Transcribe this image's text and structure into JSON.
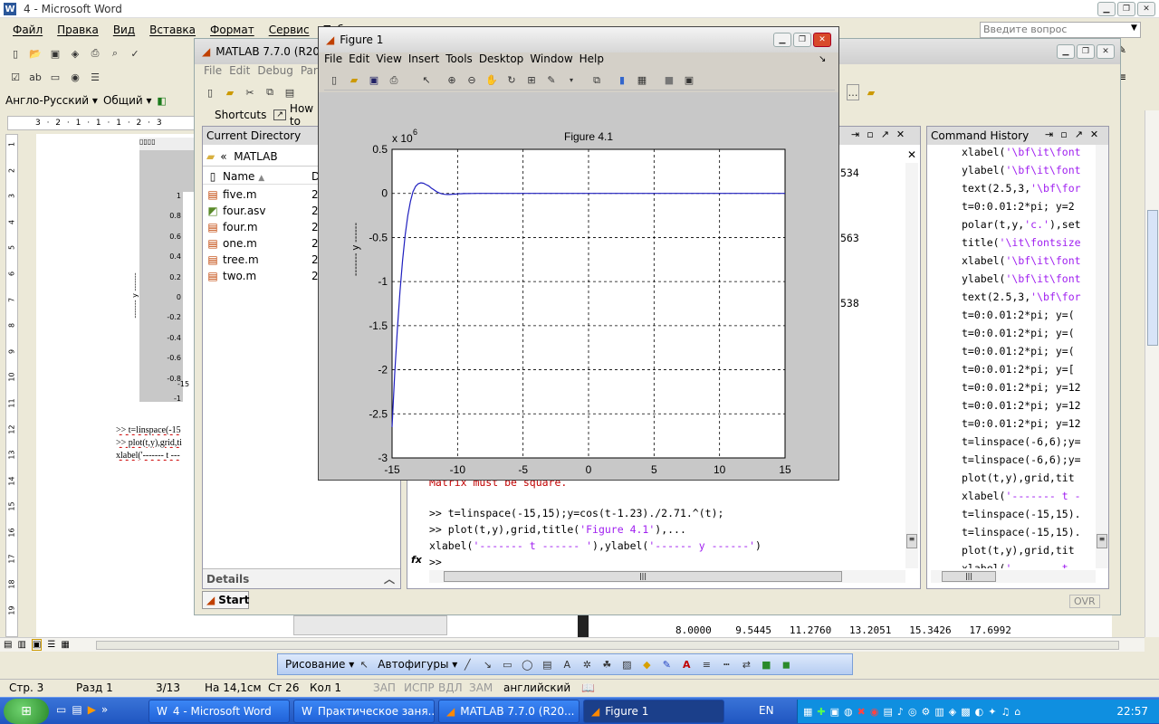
{
  "word": {
    "title": "4 - Microsoft Word",
    "menu": [
      "Файл",
      "Правка",
      "Вид",
      "Вставка",
      "Формат",
      "Сервис",
      "Табл"
    ],
    "ask_placeholder": "Введите вопрос",
    "style_box": "Англо-Русский",
    "font_box": "Общий",
    "left_ruler": [
      "1",
      "2",
      "3",
      "4",
      "5",
      "6",
      "7",
      "8",
      "9",
      "10",
      "11",
      "12",
      "13",
      "14",
      "15",
      "16",
      "17",
      "18",
      "19"
    ],
    "doc_lines": [
      ">> t=linspace(-15",
      ">> plot(t,y),grid,ti",
      "xlabel('------- t ---"
    ],
    "thumb_ticks": [
      "1",
      "0.8",
      "0.6",
      "0.4",
      "0.2",
      "0",
      "-0.2",
      "-0.4",
      "-0.6",
      "-0.8",
      "-1"
    ],
    "thumb_xtick": "-15",
    "thumb_ylabel": "------- y -------",
    "drawing_label": "Рисование",
    "autoshapes_label": "Автофигуры",
    "status": {
      "page": "Стр. 3",
      "section": "Разд 1",
      "pages": "3/13",
      "at": "На 14,1см",
      "line": "Ст 26",
      "col": "Кол 1",
      "rec": "ЗАП",
      "trk": "ИСПР",
      "ext": "ВДЛ",
      "ovr": "ЗАМ",
      "lang": "английский"
    },
    "numbers_row": "8.0000    9.5445   11.2760   13.2051   15.3426   17.6992"
  },
  "matlab": {
    "title": "MATLAB  7.7.0 (R200",
    "menu": [
      "File",
      "Edit",
      "Debug",
      "Paral"
    ],
    "shortcuts": "Shortcuts",
    "howto": "How to",
    "current_directory": "Current Directory",
    "path": "MATLAB",
    "col_name": "Name",
    "col_date": "D",
    "files": [
      {
        "name": "five.m",
        "date": "2",
        "icon": "m-file-icon"
      },
      {
        "name": "four.asv",
        "date": "2",
        "icon": "asv-file-icon"
      },
      {
        "name": "four.m",
        "date": "2",
        "icon": "m-file-icon"
      },
      {
        "name": "one.m",
        "date": "2",
        "icon": "m-file-icon"
      },
      {
        "name": "tree.m",
        "date": "2",
        "icon": "m-file-icon"
      },
      {
        "name": "two.m",
        "date": "2",
        "icon": "m-file-icon"
      }
    ],
    "details": "Details",
    "start": "Start",
    "ovr": "OVR",
    "cmd_numbers": [
      "534",
      "563",
      "538"
    ],
    "cmd_error": "Matrix must be square.",
    "cmd_lines": [
      {
        "prompt": ">> ",
        "code": "t=linspace(-15,15);y=cos(t-1.23)./2.71.^(t);",
        "str": ""
      },
      {
        "prompt": ">> ",
        "code": "plot(t,y),grid,title(",
        "str": "'Figure 4.1'",
        "tail": "),..."
      },
      {
        "prompt": "",
        "code": "xlabel(",
        "str": "'------- t ------ '",
        "tail": "),ylabel(",
        "str2": "'------ y ------'",
        "tail2": ")"
      }
    ],
    "cmd_prompt": ">>",
    "history_title": "Command History",
    "history": [
      {
        "a": "xlabel(",
        "s": "'\\bf\\it\\font"
      },
      {
        "a": "ylabel(",
        "s": "'\\bf\\it\\font"
      },
      {
        "a": "text(2.5,3,",
        "s": "'\\bf\\for"
      },
      {
        "a": "t=0:0.01:2*pi; y=2",
        "s": ""
      },
      {
        "a": "polar(t,y,",
        "s": "'c.'",
        "b": "),set"
      },
      {
        "a": "title(",
        "s": "'\\it\\fontsize"
      },
      {
        "a": "xlabel(",
        "s": "'\\bf\\it\\font"
      },
      {
        "a": "ylabel(",
        "s": "'\\bf\\it\\font"
      },
      {
        "a": "text(2.5,3,",
        "s": "'\\bf\\for"
      },
      {
        "a": "t=0:0.01:2*pi; y=(",
        "s": ""
      },
      {
        "a": "t=0:0.01:2*pi; y=(",
        "s": ""
      },
      {
        "a": "t=0:0.01:2*pi; y=(",
        "s": ""
      },
      {
        "a": "t=0:0.01:2*pi; y=[",
        "s": ""
      },
      {
        "a": "t=0:0.01:2*pi; y=12",
        "s": ""
      },
      {
        "a": "t=0:0.01:2*pi; y=12",
        "s": ""
      },
      {
        "a": "t=0:0.01:2*pi; y=12",
        "s": ""
      },
      {
        "a": "t=linspace(-6,6);y=",
        "s": ""
      },
      {
        "a": "t=linspace(-6,6);y=",
        "s": ""
      },
      {
        "a": "plot(t,y),grid,tit",
        "s": ""
      },
      {
        "a": "xlabel(",
        "s": "'------- t -"
      },
      {
        "a": "t=linspace(-15,15).",
        "s": ""
      },
      {
        "a": "t=linspace(-15,15).",
        "s": ""
      },
      {
        "a": "plot(t,y),grid,tit",
        "s": ""
      },
      {
        "a": "xlabel(",
        "s": "'------- t -"
      }
    ]
  },
  "figure": {
    "title": "Figure 1",
    "menu": [
      "File",
      "Edit",
      "View",
      "Insert",
      "Tools",
      "Desktop",
      "Window",
      "Help"
    ]
  },
  "chart_data": {
    "type": "line",
    "title": "Figure 4.1",
    "xlabel": "------- t ------",
    "ylabel": "------- y ------",
    "exponent_label": "x 10",
    "exponent_power": "6",
    "xlim": [
      -15,
      15
    ],
    "ylim": [
      -3,
      0.5
    ],
    "xticks": [
      "-15",
      "-10",
      "-5",
      "0",
      "5",
      "10",
      "15"
    ],
    "yticks": [
      "0.5",
      "0",
      "-0.5",
      "-1",
      "-1.5",
      "-2",
      "-2.5",
      "-3"
    ],
    "grid": true,
    "line_color": "#1f1fbf",
    "x": [
      -15,
      -14.8,
      -14.6,
      -14.4,
      -14.2,
      -14,
      -13.8,
      -13.6,
      -13.4,
      -13.2,
      -13,
      -12.8,
      -12.6,
      -12.4,
      -12.2,
      -12,
      -11.8,
      -11.6,
      -11.4,
      -11.2,
      -11,
      -10.8,
      -10.6,
      -10.4,
      -10.2,
      -10,
      -9.5,
      -9,
      -8.5,
      -8,
      -7.5,
      -7,
      -5,
      0,
      5,
      10,
      15
    ],
    "y": [
      -2.65,
      -2.05,
      -1.55,
      -1.12,
      -0.76,
      -0.47,
      -0.25,
      -0.09,
      0.02,
      0.08,
      0.11,
      0.12,
      0.115,
      0.1,
      0.085,
      0.06,
      0.04,
      0.02,
      0.005,
      -0.005,
      -0.01,
      -0.012,
      -0.012,
      -0.01,
      -0.008,
      -0.005,
      -0.002,
      -0.001,
      0.0005,
      0.0004,
      0.0001,
      0,
      0,
      0,
      0,
      0,
      0
    ]
  },
  "taskbar": {
    "start": "",
    "items": [
      "4 - Microsoft Word",
      "Практическое заня...",
      "MATLAB  7.7.0 (R20...",
      "Figure 1"
    ],
    "lang": "EN",
    "clock": "22:57"
  },
  "colors": {
    "xp_blue": "#245edb",
    "matlab_bg": "#d4d0c8",
    "string_purple": "#a020f0",
    "error_red": "#c00000"
  }
}
